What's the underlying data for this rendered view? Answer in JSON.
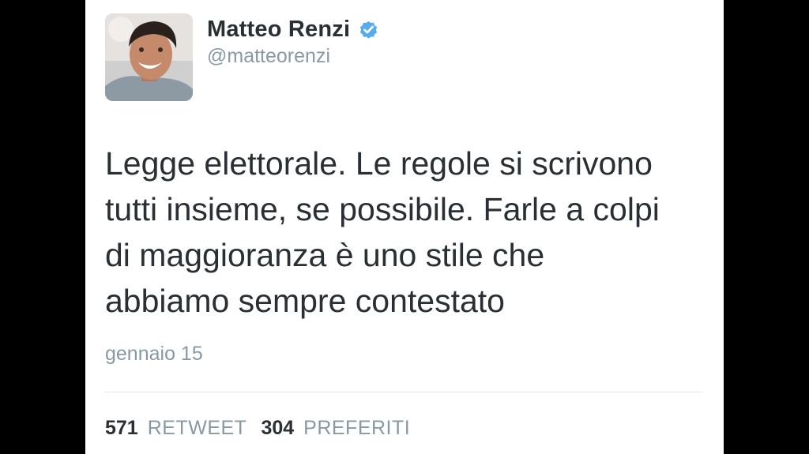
{
  "tweet": {
    "author": {
      "display_name": "Matteo Renzi",
      "handle": "@matteorenzi",
      "verified": true,
      "verified_color": "#55acee",
      "avatar_icon": "profile-photo"
    },
    "text_lines": [
      "Legge elettorale. Le regole si scrivono",
      "tutti insieme, se possibile. Farle a colpi",
      "di maggioranza è uno stile che",
      "abbiamo sempre contestato"
    ],
    "date": "gennaio 15",
    "stats": {
      "retweets": {
        "count": "571",
        "label": "RETWEET"
      },
      "favorites": {
        "count": "304",
        "label": "PREFERITI"
      }
    }
  },
  "colors": {
    "text_primary": "#292f33",
    "text_secondary": "#8899a6",
    "divider": "#e1e8ed",
    "background": "#ffffff",
    "letterbox": "#000000"
  }
}
